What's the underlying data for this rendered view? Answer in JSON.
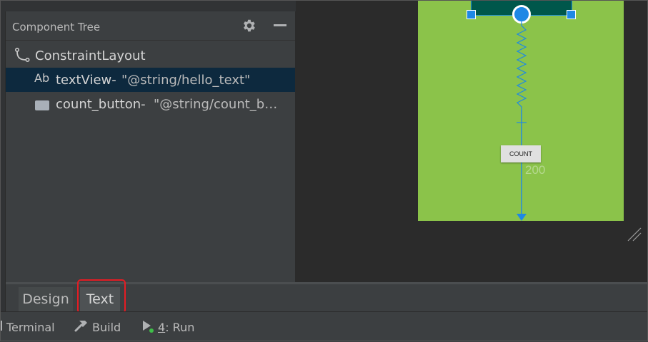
{
  "component_tree": {
    "title": "Component Tree",
    "items": [
      {
        "icon": "constraint-layout-icon",
        "label": "ConstraintLayout",
        "value": ""
      },
      {
        "icon": "text-ab-icon",
        "icon_text": "Ab",
        "label": "textView-",
        "value": "\"@string/hello_text\""
      },
      {
        "icon": "button-widget-icon",
        "label": "count_button-",
        "value": "\"@string/count_b…"
      }
    ]
  },
  "canvas": {
    "button_label": "COUNT",
    "margin_value": "200"
  },
  "editor_tabs": [
    {
      "label": "Design"
    },
    {
      "label": "Text"
    }
  ],
  "tool_windows": [
    {
      "label": "Terminal"
    },
    {
      "label": "Build"
    },
    {
      "mnemonic": "4",
      "label": ": Run"
    }
  ],
  "colors": {
    "canvas_background": "#8bc34a",
    "toolbar_block": "#00574b",
    "selection_blue": "#1e88e5",
    "selected_row": "#0d293e",
    "highlight_red": "#e51c23"
  }
}
